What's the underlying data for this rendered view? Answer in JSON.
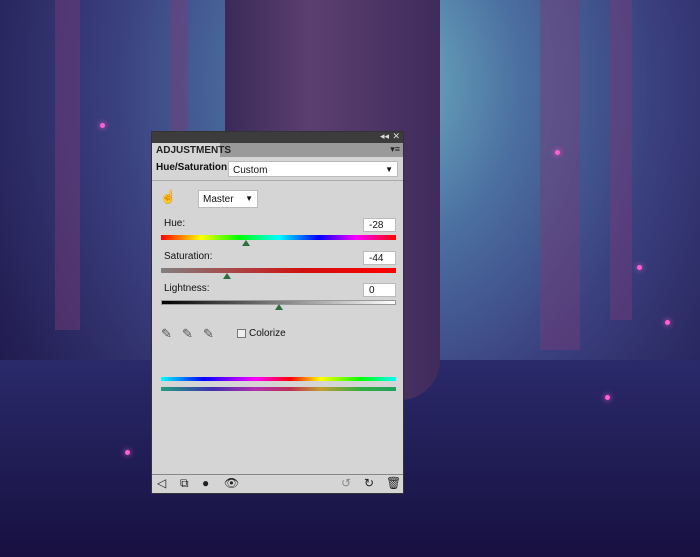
{
  "panel": {
    "tab": "ADJUSTMENTS",
    "adjustment": "Hue/Saturation",
    "preset": "Custom",
    "channel": "Master",
    "hue": {
      "label": "Hue:",
      "value": "-28"
    },
    "saturation": {
      "label": "Saturation:",
      "value": "-44"
    },
    "lightness": {
      "label": "Lightness:",
      "value": "0"
    },
    "colorize": {
      "label": "Colorize",
      "checked": false
    }
  },
  "slider_fractions": {
    "hue": 0.36,
    "saturation": 0.28,
    "lightness": 0.5
  }
}
